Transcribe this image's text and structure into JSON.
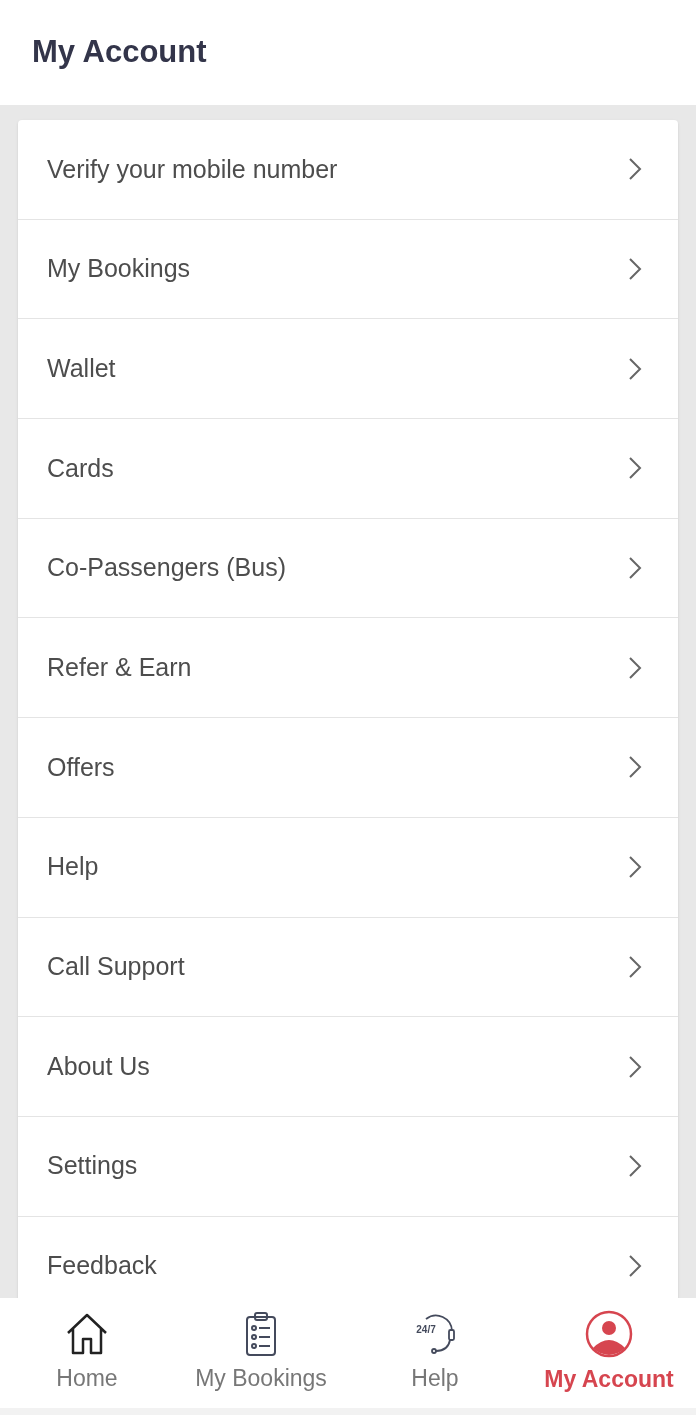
{
  "header": {
    "title": "My Account"
  },
  "menu": [
    "Verify your mobile number",
    "My Bookings",
    "Wallet",
    "Cards",
    "Co-Passengers (Bus)",
    "Refer & Earn",
    "Offers",
    "Help",
    "Call Support",
    "About Us",
    "Settings",
    "Feedback"
  ],
  "nav": [
    {
      "kind": "home",
      "label": "Home",
      "selected": false
    },
    {
      "kind": "bookings",
      "label": "My Bookings",
      "selected": false
    },
    {
      "kind": "help",
      "label": "Help",
      "icon_text": "24/7",
      "selected": false
    },
    {
      "kind": "account",
      "label": "My Account",
      "selected": true
    }
  ]
}
